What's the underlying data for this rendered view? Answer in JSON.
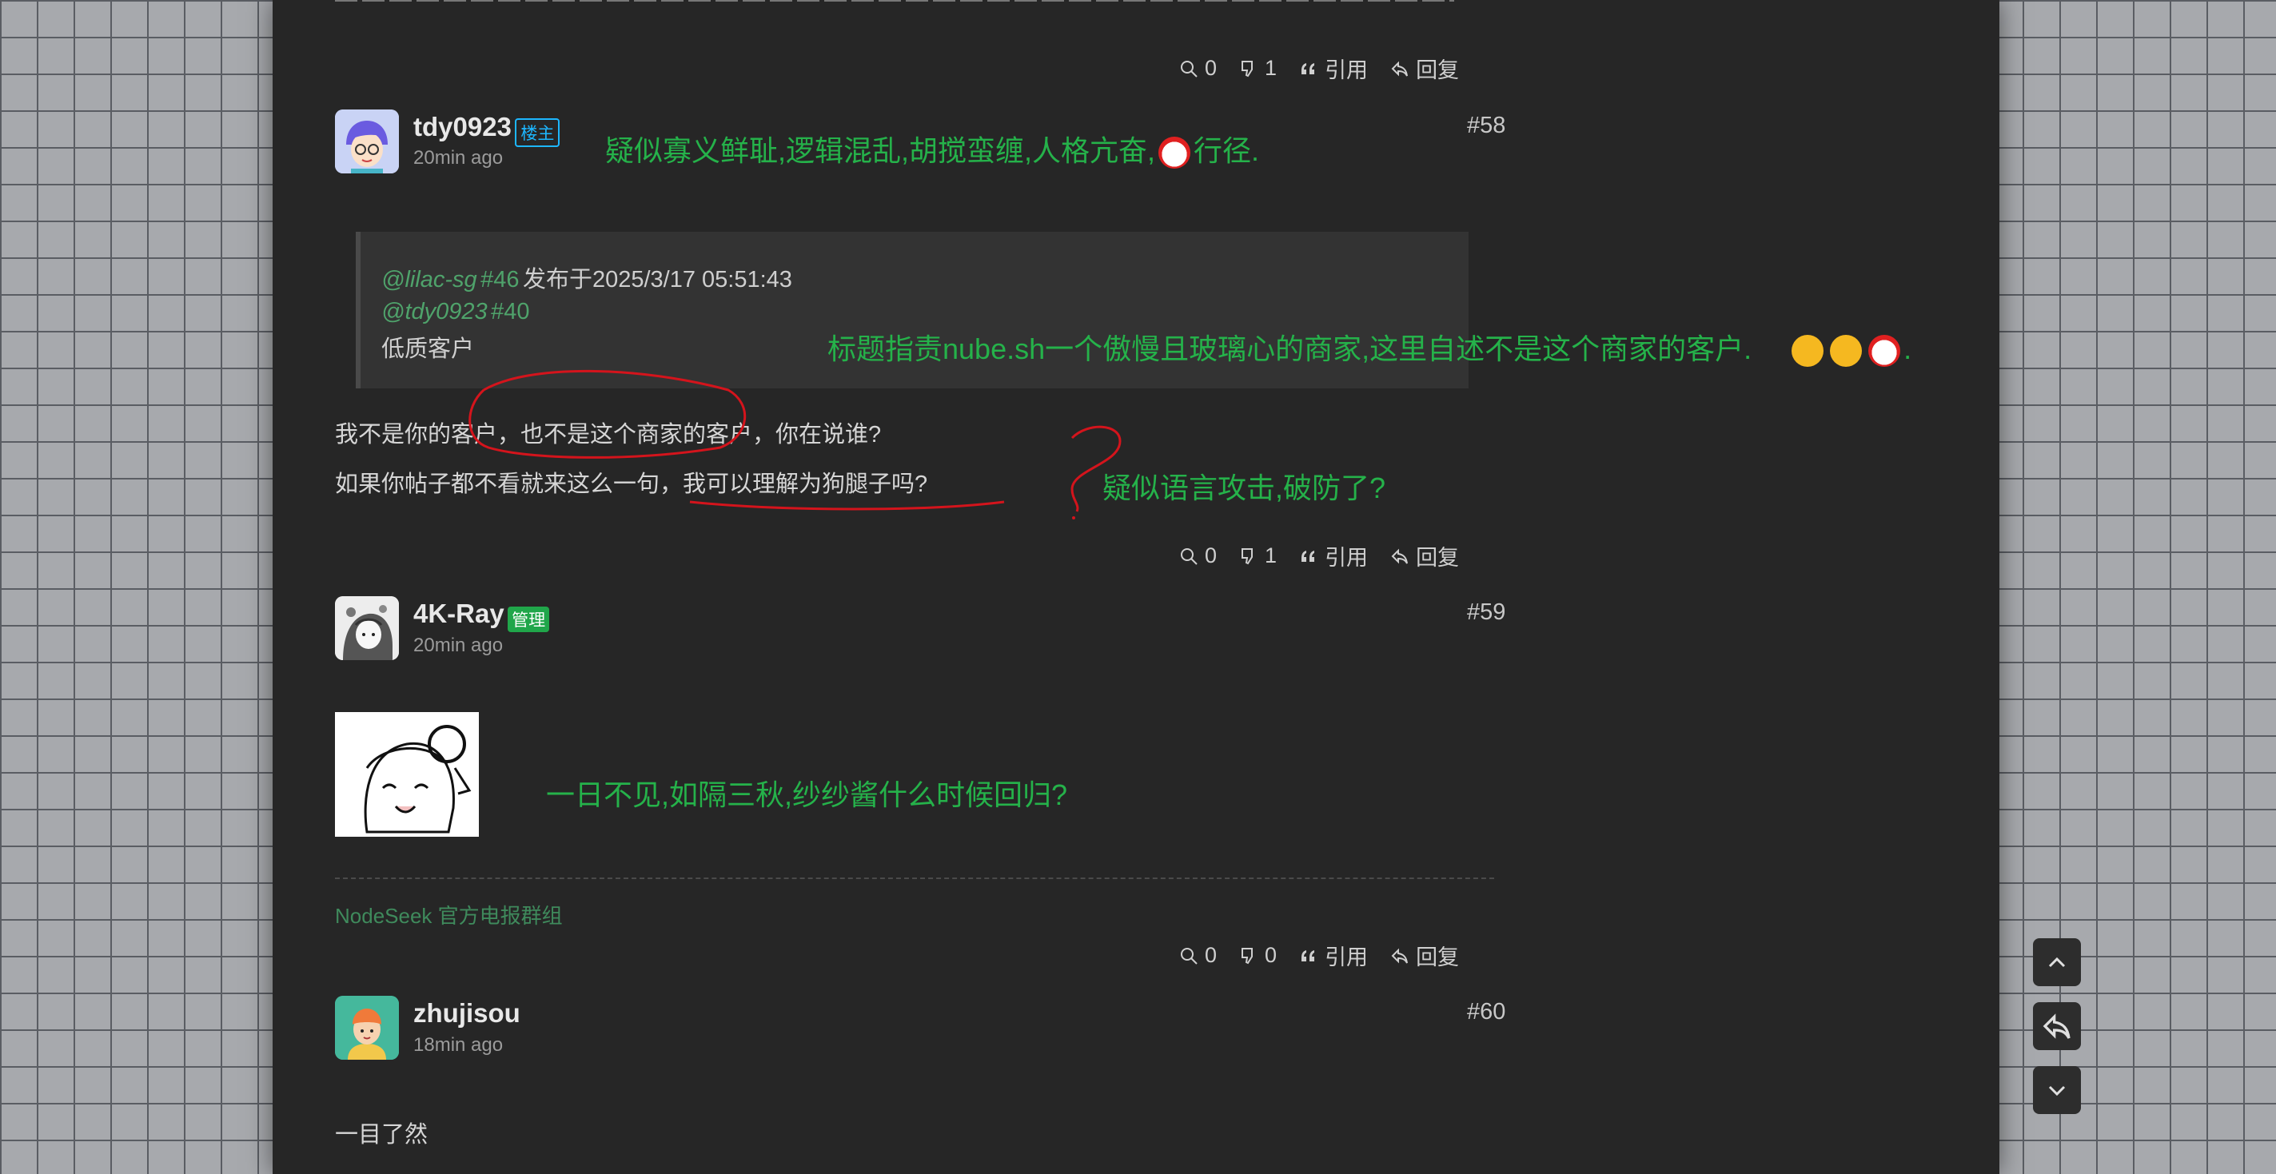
{
  "posts": [
    {
      "actions": {
        "views": "0",
        "dislikes": "1",
        "quote": "引用",
        "reply": "回复"
      }
    },
    {
      "username": "tdy0923",
      "badge": "楼主",
      "time": "20min ago",
      "floor": "#58",
      "quote": {
        "user1": "@lilac-sg",
        "floor1": "#46",
        "posted": "发布于2025/3/17 05:51:43",
        "user2": "@tdy0923",
        "floor2": "#40",
        "text": "低质客户"
      },
      "body_line1_a": "我不是你的客户，",
      "body_line1_b": "也不是这个商家的客户，",
      "body_line1_c": "你在说谁?",
      "body_line2_a": "如果你帖子都不看就来这么一句，",
      "body_line2_b": "我可以理解为狗腿子吗?",
      "actions": {
        "views": "0",
        "dislikes": "1",
        "quote": "引用",
        "reply": "回复"
      }
    },
    {
      "username": "4K-Ray",
      "badge": "管理",
      "time": "20min ago",
      "floor": "#59",
      "link": "NodeSeek 官方电报群组",
      "actions": {
        "views": "0",
        "dislikes": "0",
        "quote": "引用",
        "reply": "回复"
      }
    },
    {
      "username": "zhujisou",
      "time": "18min ago",
      "floor": "#60",
      "body": "一目了然"
    }
  ],
  "annotations": {
    "a1": "疑似寡义鲜耻,逻辑混乱,胡搅蛮缠,人格亢奋,",
    "a1_end": "行径.",
    "a2": "标题指责nube.sh一个傲慢且玻璃心的商家,这里自述不是这个商家的客户.",
    "a2_end": ".",
    "a3": "疑似语言攻击,破防了?",
    "a4": "一日不见,如隔三秋,纱纱酱什么时候回归?"
  },
  "colors": {
    "annotation": "#25b24a",
    "op_badge": "#1db7ff",
    "admin_badge": "#20a64a",
    "panel": "#262626",
    "handwriting": "#d4141c"
  },
  "icons": {
    "views": "zoom-icon",
    "dislikes": "thumbs-down-icon",
    "quote": "quote-icon",
    "reply": "reply-icon",
    "scroll_up": "chevron-up-icon",
    "side_reply": "reply-icon",
    "scroll_down": "chevron-down-icon"
  }
}
